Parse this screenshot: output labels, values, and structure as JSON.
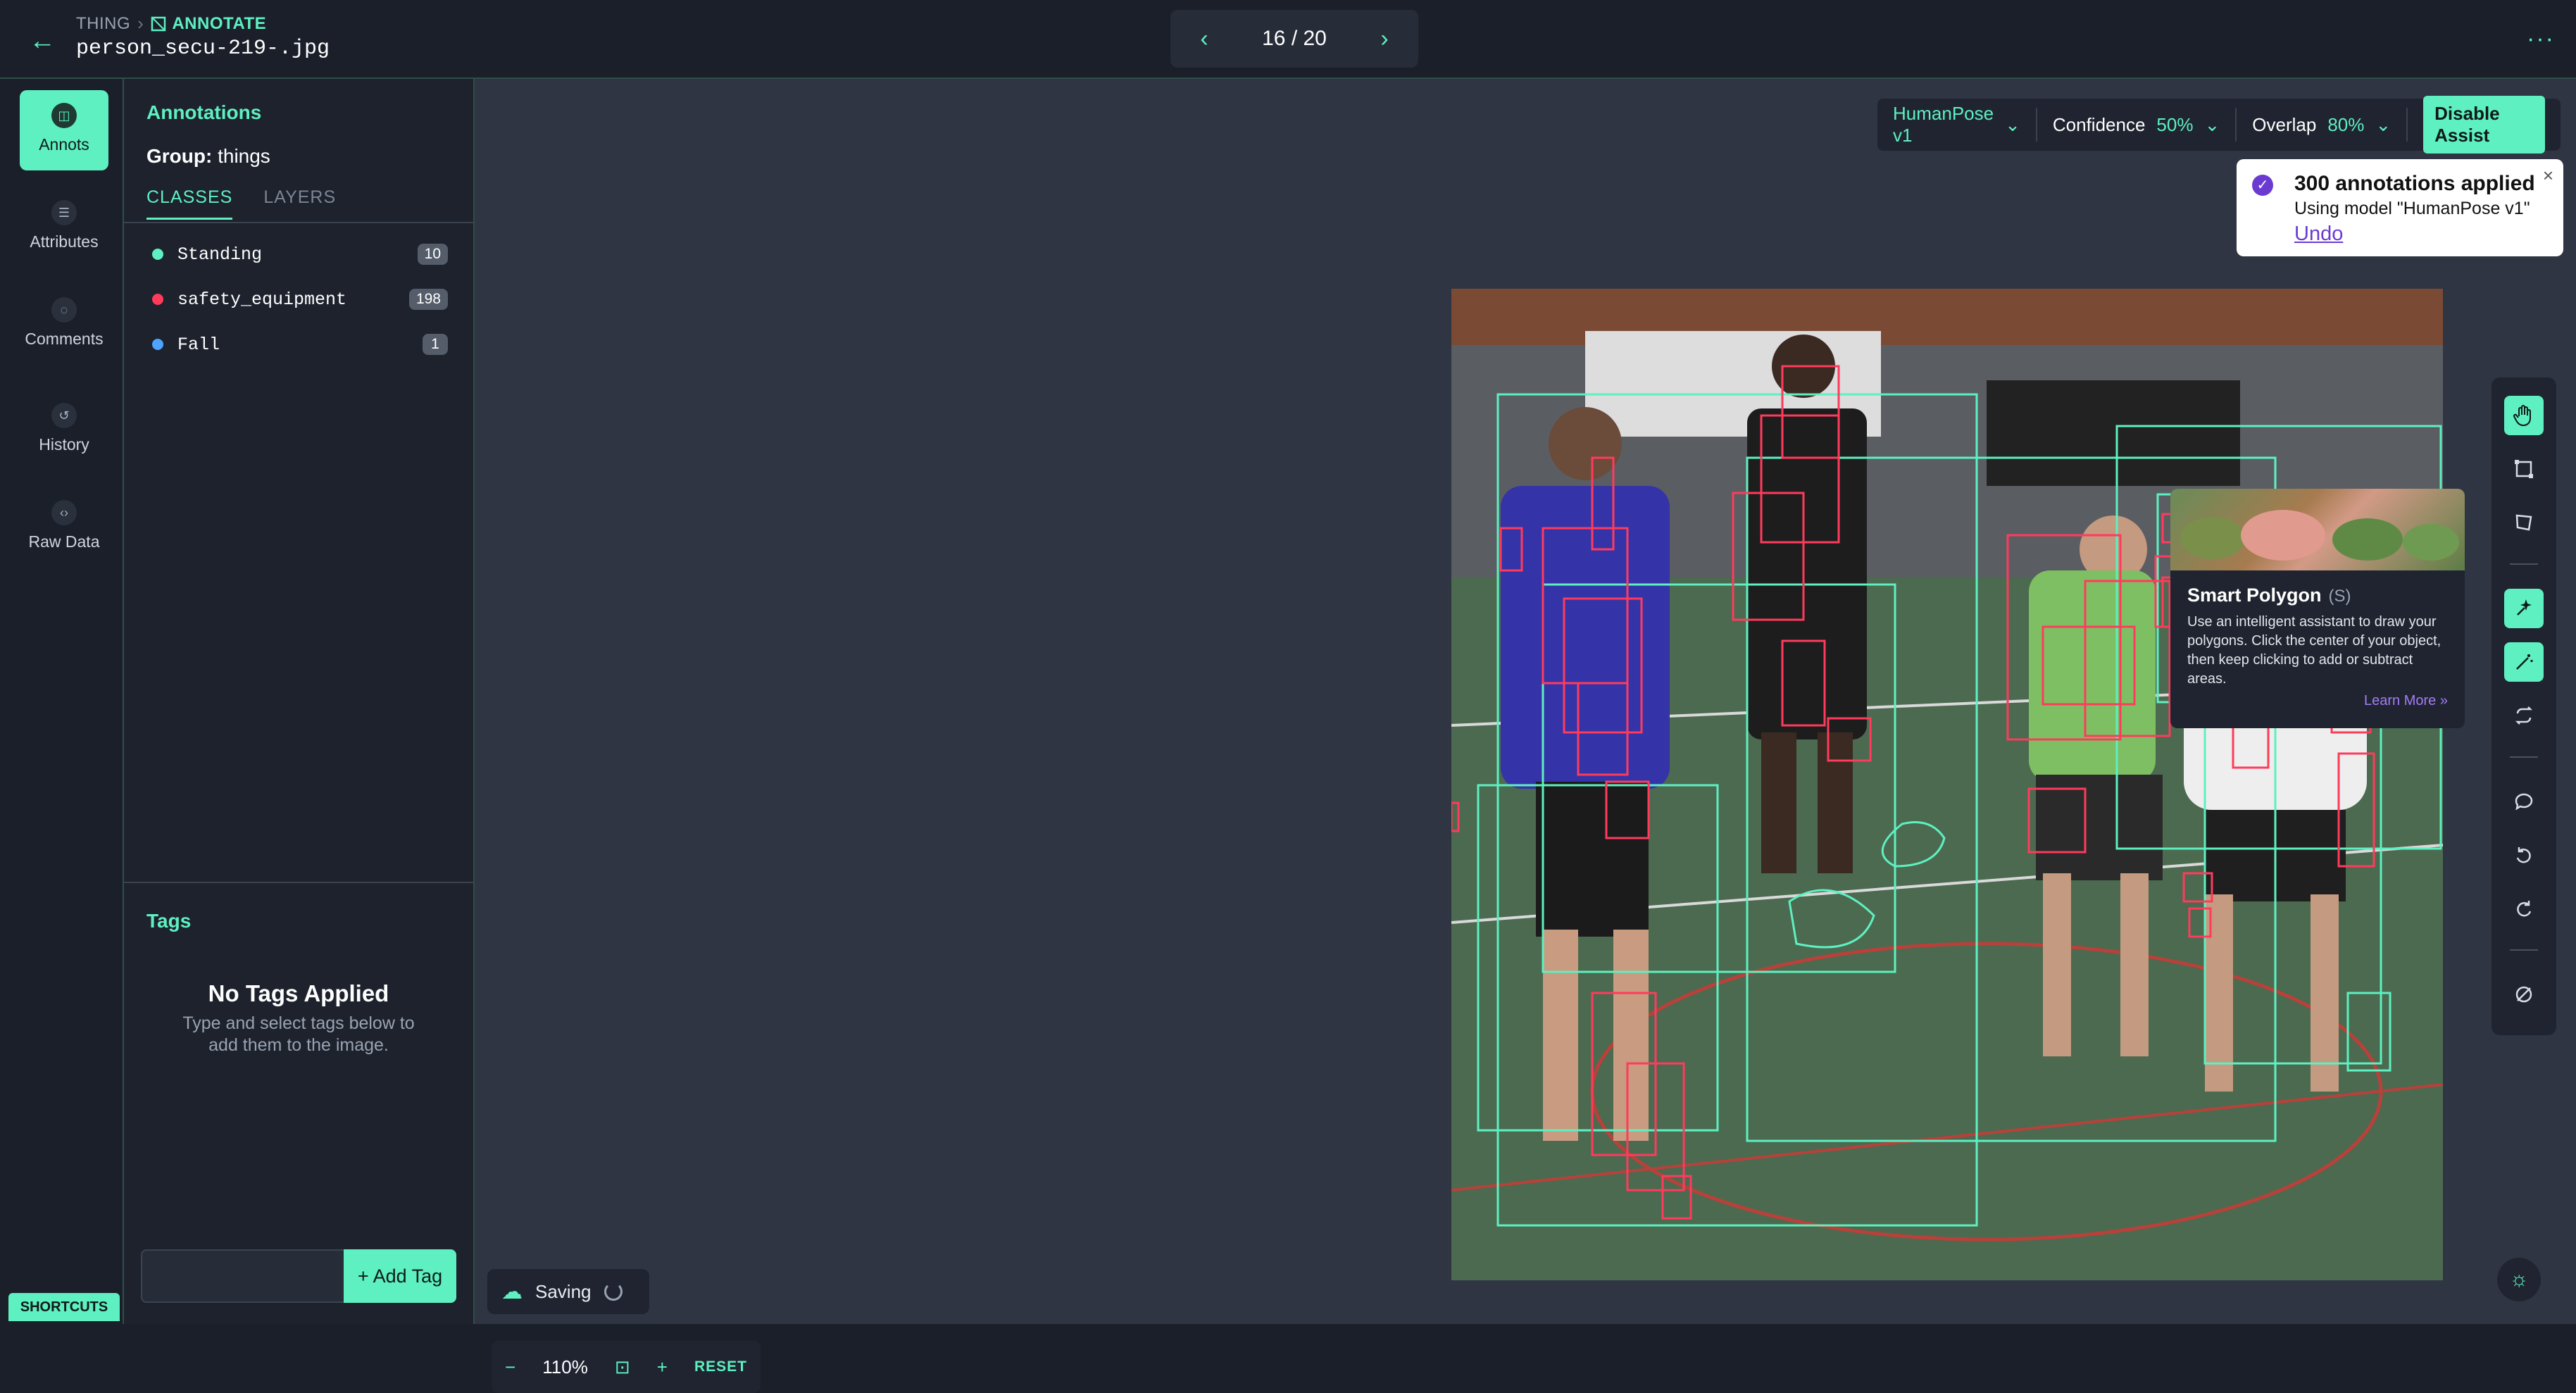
{
  "header": {
    "breadcrumb_root": "THING",
    "breadcrumb_current": "ANNOTATE",
    "filename": "person_secu-219-.jpg",
    "pager": "16 / 20"
  },
  "rail": {
    "items": [
      {
        "label": "Annots",
        "icon": "annotations-icon",
        "active": true
      },
      {
        "label": "Attributes",
        "icon": "list-icon",
        "active": false
      },
      {
        "label": "Comments",
        "icon": "comment-icon",
        "active": false
      },
      {
        "label": "History",
        "icon": "history-icon",
        "active": false
      },
      {
        "label": "Raw Data",
        "icon": "code-icon",
        "active": false
      }
    ],
    "shortcuts": "SHORTCUTS"
  },
  "sidebar": {
    "title": "Annotations",
    "group_label": "Group:",
    "group_value": "things",
    "tabs": [
      "CLASSES",
      "LAYERS"
    ],
    "classes": [
      {
        "name": "Standing",
        "count": "10",
        "color": "#5ef0c1"
      },
      {
        "name": "safety_equipment",
        "count": "198",
        "color": "#ff3b5c"
      },
      {
        "name": "Fall",
        "count": "1",
        "color": "#4da3ff"
      }
    ],
    "tags_title": "Tags",
    "empty_title": "No Tags Applied",
    "empty_sub": "Type and select tags below to add them to the image.",
    "tag_placeholder": "",
    "add_tag": "+ Add Tag"
  },
  "toolbar": {
    "model": "HumanPose v1",
    "confidence_label": "Confidence",
    "confidence_value": "50%",
    "overlap_label": "Overlap",
    "overlap_value": "80%",
    "disable_assist": "Disable Assist"
  },
  "toast": {
    "title": "300 annotations applied",
    "subtitle": "Using model \"HumanPose v1\"",
    "undo": "Undo"
  },
  "tooltip": {
    "title": "Smart Polygon",
    "shortcut": "(S)",
    "body": "Use an intelligent assistant to draw your polygons. Click the center of your object, then keep clicking to add or subtract areas.",
    "learn_more": "Learn More »"
  },
  "status": {
    "saving": "Saving",
    "zoom": "110%",
    "reset": "RESET"
  },
  "colors": {
    "accent": "#5ef0c1",
    "annotation_box": "#5ef0c1",
    "annotation_poly": "#ff3b5c"
  }
}
